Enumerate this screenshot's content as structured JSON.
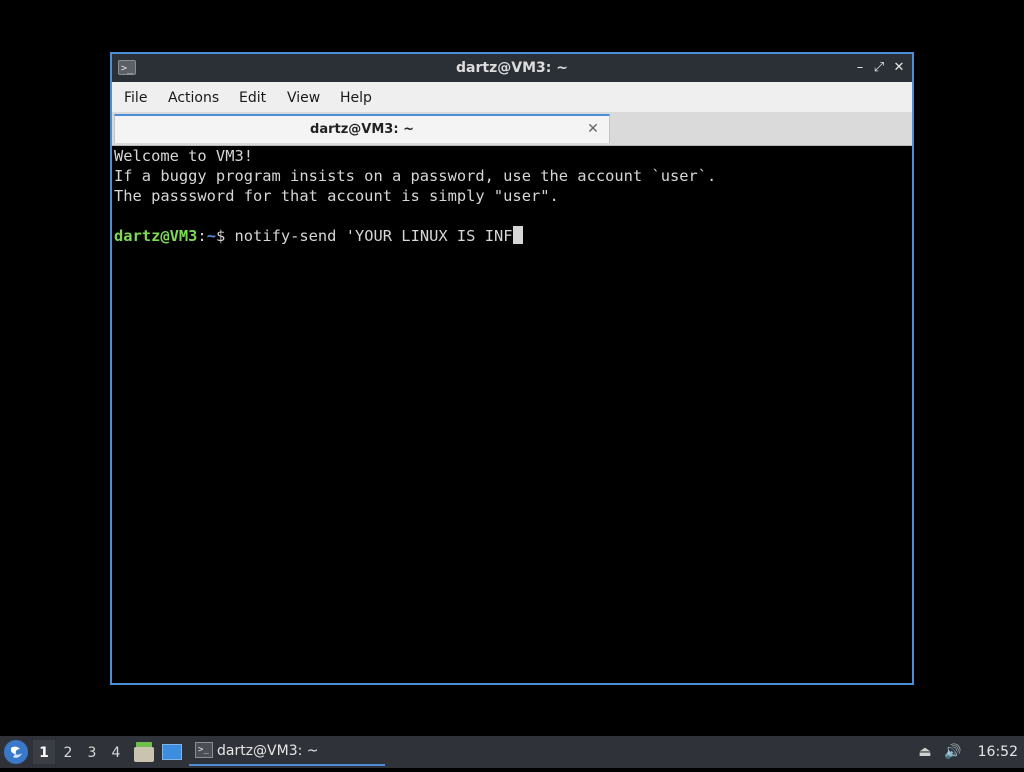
{
  "window": {
    "title": "dartz@VM3: ~",
    "app_icon": ">_",
    "controls": {
      "minimize": "–",
      "maximize": "⤢",
      "close": "✕"
    }
  },
  "menubar": {
    "items": [
      {
        "label": "File"
      },
      {
        "label": "Actions"
      },
      {
        "label": "Edit"
      },
      {
        "label": "View"
      },
      {
        "label": "Help"
      }
    ]
  },
  "tabs": [
    {
      "label": "dartz@VM3: ~",
      "close": "✕"
    }
  ],
  "terminal": {
    "lines": [
      "Welcome to VM3!",
      "If a buggy program insists on a password, use the account `user`.",
      "The passsword for that account is simply \"user\".",
      ""
    ],
    "prompt": {
      "user_host": "dartz@VM3",
      "separator": ":",
      "path": "~",
      "symbol": "$ "
    },
    "current_input": "notify-send 'YOUR LINUX IS INF"
  },
  "taskbar": {
    "start_icon": "menu-icon",
    "workspaces": [
      {
        "label": "1",
        "active": true
      },
      {
        "label": "2",
        "active": false
      },
      {
        "label": "3",
        "active": false
      },
      {
        "label": "4",
        "active": false
      }
    ],
    "task": {
      "label": "dartz@VM3: ~",
      "icon": ">_"
    },
    "tray": {
      "network": "⏏",
      "volume": "🔊"
    },
    "clock": "16:52"
  },
  "colors": {
    "accent": "#4d8fd6",
    "prompt_user": "#7ed957",
    "prompt_path": "#5b8ede",
    "terminal_bg": "#000000",
    "terminal_fg": "#d6d6d6"
  }
}
